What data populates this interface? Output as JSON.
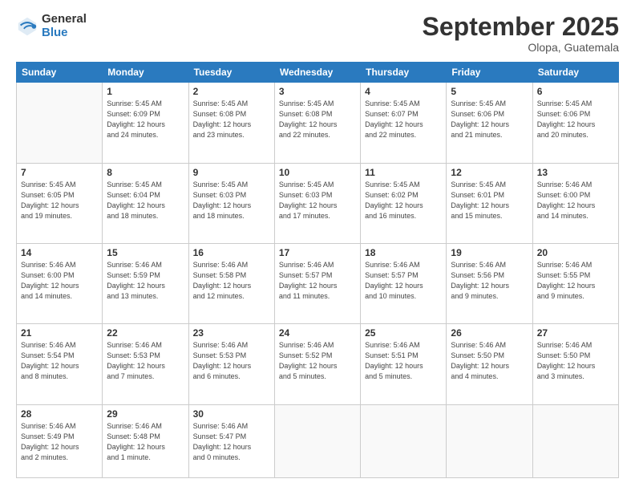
{
  "logo": {
    "general": "General",
    "blue": "Blue"
  },
  "header": {
    "month": "September 2025",
    "location": "Olopa, Guatemala"
  },
  "weekdays": [
    "Sunday",
    "Monday",
    "Tuesday",
    "Wednesday",
    "Thursday",
    "Friday",
    "Saturday"
  ],
  "weeks": [
    [
      {
        "day": "",
        "info": ""
      },
      {
        "day": "1",
        "info": "Sunrise: 5:45 AM\nSunset: 6:09 PM\nDaylight: 12 hours\nand 24 minutes."
      },
      {
        "day": "2",
        "info": "Sunrise: 5:45 AM\nSunset: 6:08 PM\nDaylight: 12 hours\nand 23 minutes."
      },
      {
        "day": "3",
        "info": "Sunrise: 5:45 AM\nSunset: 6:08 PM\nDaylight: 12 hours\nand 22 minutes."
      },
      {
        "day": "4",
        "info": "Sunrise: 5:45 AM\nSunset: 6:07 PM\nDaylight: 12 hours\nand 22 minutes."
      },
      {
        "day": "5",
        "info": "Sunrise: 5:45 AM\nSunset: 6:06 PM\nDaylight: 12 hours\nand 21 minutes."
      },
      {
        "day": "6",
        "info": "Sunrise: 5:45 AM\nSunset: 6:06 PM\nDaylight: 12 hours\nand 20 minutes."
      }
    ],
    [
      {
        "day": "7",
        "info": "Sunrise: 5:45 AM\nSunset: 6:05 PM\nDaylight: 12 hours\nand 19 minutes."
      },
      {
        "day": "8",
        "info": "Sunrise: 5:45 AM\nSunset: 6:04 PM\nDaylight: 12 hours\nand 18 minutes."
      },
      {
        "day": "9",
        "info": "Sunrise: 5:45 AM\nSunset: 6:03 PM\nDaylight: 12 hours\nand 18 minutes."
      },
      {
        "day": "10",
        "info": "Sunrise: 5:45 AM\nSunset: 6:03 PM\nDaylight: 12 hours\nand 17 minutes."
      },
      {
        "day": "11",
        "info": "Sunrise: 5:45 AM\nSunset: 6:02 PM\nDaylight: 12 hours\nand 16 minutes."
      },
      {
        "day": "12",
        "info": "Sunrise: 5:45 AM\nSunset: 6:01 PM\nDaylight: 12 hours\nand 15 minutes."
      },
      {
        "day": "13",
        "info": "Sunrise: 5:46 AM\nSunset: 6:00 PM\nDaylight: 12 hours\nand 14 minutes."
      }
    ],
    [
      {
        "day": "14",
        "info": "Sunrise: 5:46 AM\nSunset: 6:00 PM\nDaylight: 12 hours\nand 14 minutes."
      },
      {
        "day": "15",
        "info": "Sunrise: 5:46 AM\nSunset: 5:59 PM\nDaylight: 12 hours\nand 13 minutes."
      },
      {
        "day": "16",
        "info": "Sunrise: 5:46 AM\nSunset: 5:58 PM\nDaylight: 12 hours\nand 12 minutes."
      },
      {
        "day": "17",
        "info": "Sunrise: 5:46 AM\nSunset: 5:57 PM\nDaylight: 12 hours\nand 11 minutes."
      },
      {
        "day": "18",
        "info": "Sunrise: 5:46 AM\nSunset: 5:57 PM\nDaylight: 12 hours\nand 10 minutes."
      },
      {
        "day": "19",
        "info": "Sunrise: 5:46 AM\nSunset: 5:56 PM\nDaylight: 12 hours\nand 9 minutes."
      },
      {
        "day": "20",
        "info": "Sunrise: 5:46 AM\nSunset: 5:55 PM\nDaylight: 12 hours\nand 9 minutes."
      }
    ],
    [
      {
        "day": "21",
        "info": "Sunrise: 5:46 AM\nSunset: 5:54 PM\nDaylight: 12 hours\nand 8 minutes."
      },
      {
        "day": "22",
        "info": "Sunrise: 5:46 AM\nSunset: 5:53 PM\nDaylight: 12 hours\nand 7 minutes."
      },
      {
        "day": "23",
        "info": "Sunrise: 5:46 AM\nSunset: 5:53 PM\nDaylight: 12 hours\nand 6 minutes."
      },
      {
        "day": "24",
        "info": "Sunrise: 5:46 AM\nSunset: 5:52 PM\nDaylight: 12 hours\nand 5 minutes."
      },
      {
        "day": "25",
        "info": "Sunrise: 5:46 AM\nSunset: 5:51 PM\nDaylight: 12 hours\nand 5 minutes."
      },
      {
        "day": "26",
        "info": "Sunrise: 5:46 AM\nSunset: 5:50 PM\nDaylight: 12 hours\nand 4 minutes."
      },
      {
        "day": "27",
        "info": "Sunrise: 5:46 AM\nSunset: 5:50 PM\nDaylight: 12 hours\nand 3 minutes."
      }
    ],
    [
      {
        "day": "28",
        "info": "Sunrise: 5:46 AM\nSunset: 5:49 PM\nDaylight: 12 hours\nand 2 minutes."
      },
      {
        "day": "29",
        "info": "Sunrise: 5:46 AM\nSunset: 5:48 PM\nDaylight: 12 hours\nand 1 minute."
      },
      {
        "day": "30",
        "info": "Sunrise: 5:46 AM\nSunset: 5:47 PM\nDaylight: 12 hours\nand 0 minutes."
      },
      {
        "day": "",
        "info": ""
      },
      {
        "day": "",
        "info": ""
      },
      {
        "day": "",
        "info": ""
      },
      {
        "day": "",
        "info": ""
      }
    ]
  ]
}
